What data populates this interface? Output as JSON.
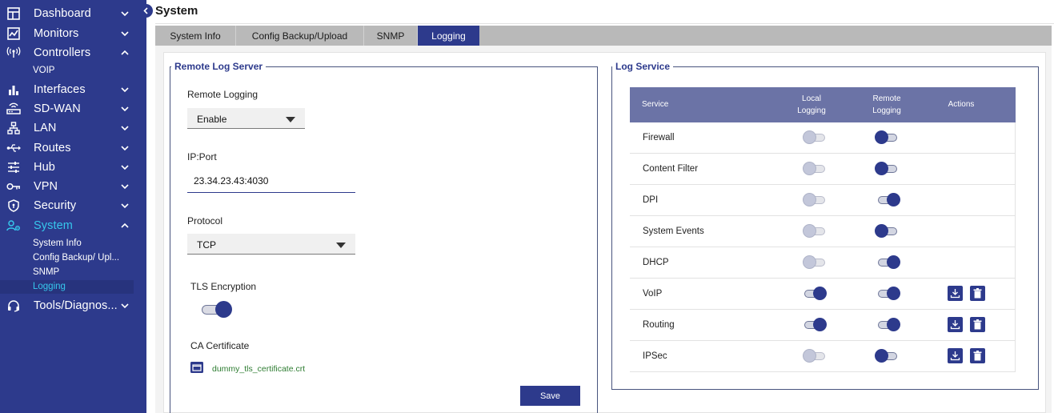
{
  "sidebar": {
    "items": [
      {
        "label": "Dashboard",
        "icon": "dashboard-icon",
        "chevron": "down"
      },
      {
        "label": "Monitors",
        "icon": "monitor-chart-icon",
        "chevron": "down"
      },
      {
        "label": "Controllers",
        "icon": "antenna-icon",
        "chevron": "up"
      },
      {
        "label": "Interfaces",
        "icon": "bar-chart-icon",
        "chevron": "down"
      },
      {
        "label": "SD-WAN",
        "icon": "router-icon",
        "chevron": "down"
      },
      {
        "label": "LAN",
        "icon": "lan-tree-icon",
        "chevron": "down"
      },
      {
        "label": "Routes",
        "icon": "usb-routes-icon",
        "chevron": "down"
      },
      {
        "label": "Hub",
        "icon": "sliders-icon",
        "chevron": "down"
      },
      {
        "label": "VPN",
        "icon": "key-icon",
        "chevron": "down"
      },
      {
        "label": "Security",
        "icon": "shield-icon",
        "chevron": "down"
      },
      {
        "label": "System",
        "icon": "system-users-icon",
        "chevron": "up",
        "active": true
      },
      {
        "label": "Tools/Diagnos...",
        "icon": "headset-icon",
        "chevron": "down"
      }
    ],
    "controllers_sub": [
      "VOIP"
    ],
    "system_sub": [
      "System Info",
      "Config Backup/ Upl...",
      "SNMP",
      "Logging"
    ]
  },
  "header": {
    "title": "System"
  },
  "tabs": [
    "System Info",
    "Config Backup/Upload",
    "SNMP",
    "Logging"
  ],
  "active_tab": "Logging",
  "remote_log": {
    "legend": "Remote Log Server",
    "remote_logging_label": "Remote Logging",
    "remote_logging_value": "Enable",
    "ip_label": "IP:Port",
    "ip_value": "23.34.23.43:4030",
    "protocol_label": "Protocol",
    "protocol_value": "TCP",
    "tls_label": "TLS Encryption",
    "tls_enabled": true,
    "ca_label": "CA Certificate",
    "ca_file": "dummy_tls_certificate.crt",
    "save_label": "Save"
  },
  "log_service": {
    "legend": "Log Service",
    "headers": {
      "service": "Service",
      "local_1": "Local",
      "local_2": "Logging",
      "remote_1": "Remote",
      "remote_2": "Logging",
      "actions": "Actions"
    },
    "rows": [
      {
        "service": "Firewall",
        "local": "off-disabled",
        "remote": "off",
        "actions": false
      },
      {
        "service": "Content Filter",
        "local": "off-disabled",
        "remote": "off",
        "actions": false
      },
      {
        "service": "DPI",
        "local": "off-disabled",
        "remote": "on",
        "actions": false
      },
      {
        "service": "System Events",
        "local": "off-disabled",
        "remote": "off",
        "actions": false
      },
      {
        "service": "DHCP",
        "local": "off-disabled",
        "remote": "on",
        "actions": false
      },
      {
        "service": "VoIP",
        "local": "on",
        "remote": "on",
        "actions": true
      },
      {
        "service": "Routing",
        "local": "on",
        "remote": "on",
        "actions": true
      },
      {
        "service": "IPSec",
        "local": "off-disabled",
        "remote": "off",
        "actions": true
      }
    ]
  },
  "colors": {
    "brand": "#2d3a8c",
    "accent": "#36c7ec",
    "table_header": "#6b73a6",
    "file_link": "#2e7d32"
  }
}
